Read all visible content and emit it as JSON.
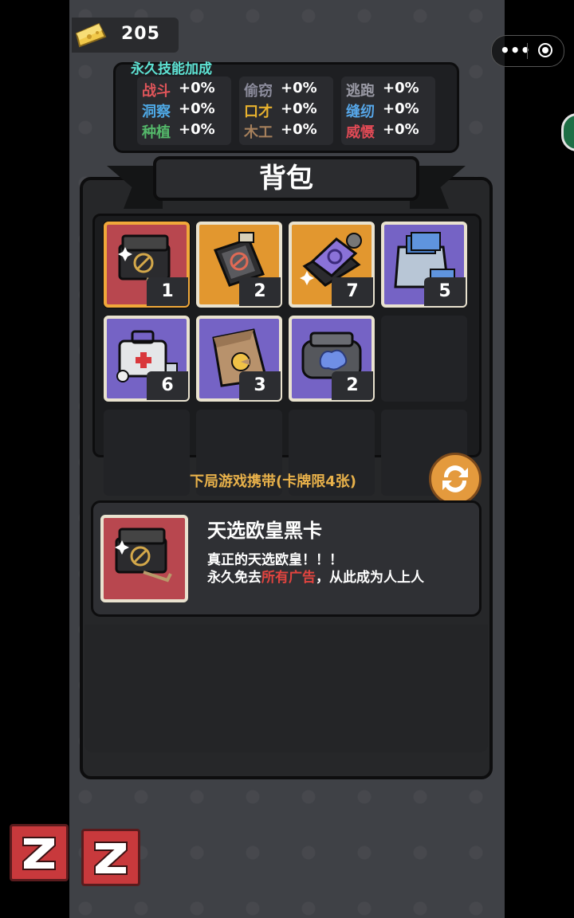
{
  "currency": {
    "icon": "cheese-icon",
    "value": "205"
  },
  "skills": {
    "title": "永久技能加成",
    "columns": [
      [
        {
          "name": "战斗",
          "value": "+0%",
          "color": "#e0555a"
        },
        {
          "name": "洞察",
          "value": "+0%",
          "color": "#4ea9e6"
        },
        {
          "name": "种植",
          "value": "+0%",
          "color": "#54b86a"
        }
      ],
      [
        {
          "name": "偷窃",
          "value": "+0%",
          "color": "#8c8c9c"
        },
        {
          "name": "口才",
          "value": "+0%",
          "color": "#e8b22e"
        },
        {
          "name": "木工",
          "value": "+0%",
          "color": "#a6805c"
        }
      ],
      [
        {
          "name": "逃跑",
          "value": "+0%",
          "color": "#9a9aa5"
        },
        {
          "name": "缝纫",
          "value": "+0%",
          "color": "#56a6e8"
        },
        {
          "name": "威慑",
          "value": "+0%",
          "color": "#e04a55"
        }
      ]
    ]
  },
  "backpack": {
    "title": "背包",
    "items": [
      {
        "icon": "black-card-box-icon",
        "count": "1",
        "bg": "red",
        "selected": true
      },
      {
        "icon": "ad-blocker-card-icon",
        "count": "2",
        "bg": "orange",
        "selected": false
      },
      {
        "icon": "purple-card-box-icon",
        "count": "7",
        "bg": "orange",
        "selected": false
      },
      {
        "icon": "money-bag-icon",
        "count": "5",
        "bg": "purple",
        "selected": false
      },
      {
        "icon": "first-aid-kit-icon",
        "count": "6",
        "bg": "purple",
        "selected": false
      },
      {
        "icon": "cheese-sack-icon",
        "count": "3",
        "bg": "purple",
        "selected": false
      },
      {
        "icon": "brain-case-icon",
        "count": "2",
        "bg": "purple",
        "selected": false
      }
    ]
  },
  "carry": {
    "label": "下局游戏携带(卡牌限4张)",
    "swap_icon": "swap-icon"
  },
  "detail": {
    "name": "天选欧皇黑卡",
    "line1": "真正的天选欧皇！！！",
    "line2_prefix": "永久免去",
    "line2_highlight": "所有广告",
    "line2_suffix": "，从此成为人上人"
  },
  "capsule": {
    "more_icon": "more-icon",
    "close_icon": "target-icon"
  }
}
